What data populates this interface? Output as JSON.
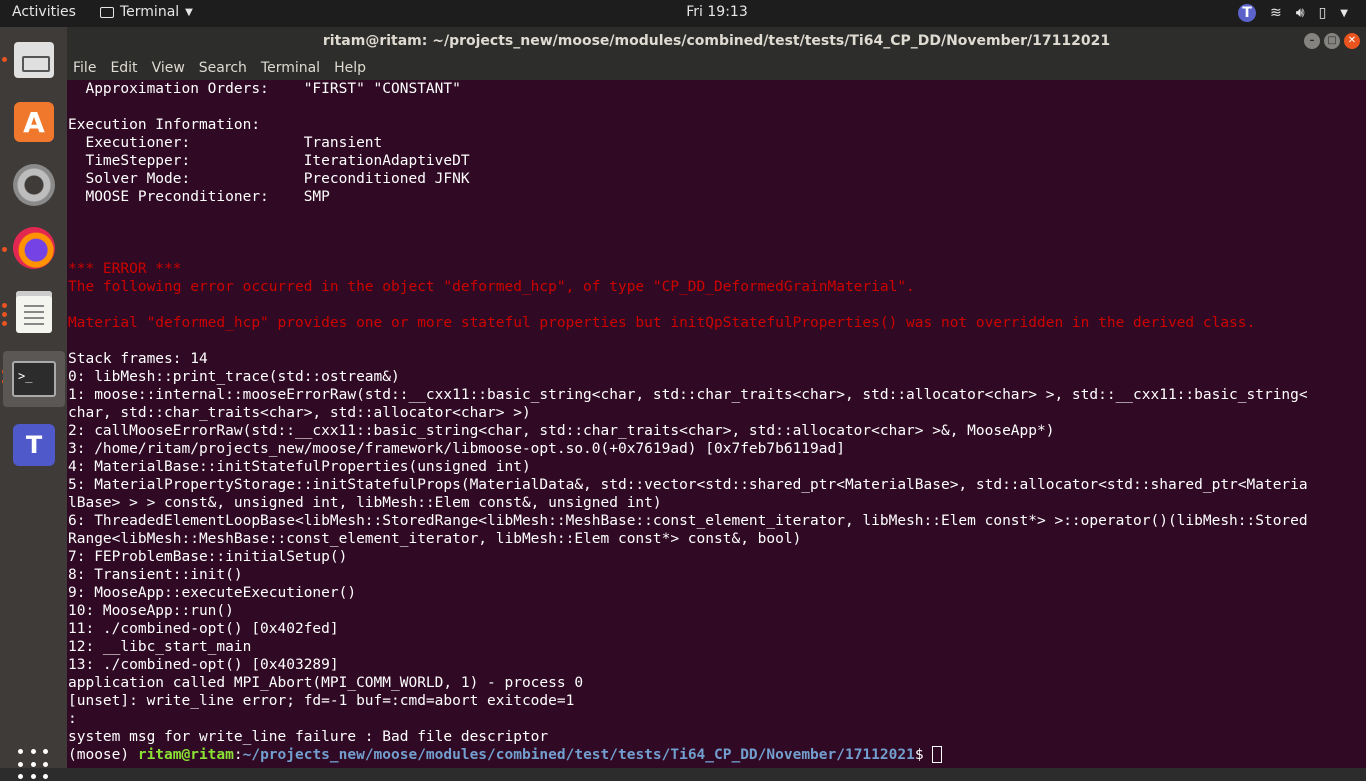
{
  "topbar": {
    "activities": "Activities",
    "app_name": "Terminal",
    "clock": "Fri 19:13"
  },
  "dock": {
    "items": [
      "files",
      "software-center",
      "settings",
      "firefox",
      "text-editor",
      "terminal",
      "teams"
    ],
    "accent": "#e95420"
  },
  "window": {
    "title": "ritam@ritam: ~/projects_new/moose/modules/combined/test/tests/Ti64_CP_DD/November/17112021",
    "menu": [
      "File",
      "Edit",
      "View",
      "Search",
      "Terminal",
      "Help"
    ]
  },
  "terminal": {
    "background": "#300a24",
    "lines": [
      {
        "text": "  Approximation Orders:    \"FIRST\" \"CONSTANT\"",
        "err": false
      },
      {
        "text": "",
        "err": false
      },
      {
        "text": "Execution Information:",
        "err": false
      },
      {
        "text": "  Executioner:             Transient",
        "err": false
      },
      {
        "text": "  TimeStepper:             IterationAdaptiveDT",
        "err": false
      },
      {
        "text": "  Solver Mode:             Preconditioned JFNK",
        "err": false
      },
      {
        "text": "  MOOSE Preconditioner:    SMP",
        "err": false
      },
      {
        "text": "",
        "err": false
      },
      {
        "text": "",
        "err": false
      },
      {
        "text": "",
        "err": false
      },
      {
        "text": "*** ERROR ***",
        "err": true
      },
      {
        "text": "The following error occurred in the object \"deformed_hcp\", of type \"CP_DD_DeformedGrainMaterial\".",
        "err": true
      },
      {
        "text": "",
        "err": false
      },
      {
        "text": "Material \"deformed_hcp\" provides one or more stateful properties but initQpStatefulProperties() was not overridden in the derived class.",
        "err": true
      },
      {
        "text": "",
        "err": false
      },
      {
        "text": "Stack frames: 14",
        "err": false
      },
      {
        "text": "0: libMesh::print_trace(std::ostream&)",
        "err": false
      },
      {
        "text": "1: moose::internal::mooseErrorRaw(std::__cxx11::basic_string<char, std::char_traits<char>, std::allocator<char> >, std::__cxx11::basic_string<",
        "err": false
      },
      {
        "text": "char, std::char_traits<char>, std::allocator<char> >)",
        "err": false
      },
      {
        "text": "2: callMooseErrorRaw(std::__cxx11::basic_string<char, std::char_traits<char>, std::allocator<char> >&, MooseApp*)",
        "err": false
      },
      {
        "text": "3: /home/ritam/projects_new/moose/framework/libmoose-opt.so.0(+0x7619ad) [0x7feb7b6119ad]",
        "err": false
      },
      {
        "text": "4: MaterialBase::initStatefulProperties(unsigned int)",
        "err": false
      },
      {
        "text": "5: MaterialPropertyStorage::initStatefulProps(MaterialData&, std::vector<std::shared_ptr<MaterialBase>, std::allocator<std::shared_ptr<Materia",
        "err": false
      },
      {
        "text": "lBase> > > const&, unsigned int, libMesh::Elem const&, unsigned int)",
        "err": false
      },
      {
        "text": "6: ThreadedElementLoopBase<libMesh::StoredRange<libMesh::MeshBase::const_element_iterator, libMesh::Elem const*> >::operator()(libMesh::Stored",
        "err": false
      },
      {
        "text": "Range<libMesh::MeshBase::const_element_iterator, libMesh::Elem const*> const&, bool)",
        "err": false
      },
      {
        "text": "7: FEProblemBase::initialSetup()",
        "err": false
      },
      {
        "text": "8: Transient::init()",
        "err": false
      },
      {
        "text": "9: MooseApp::executeExecutioner()",
        "err": false
      },
      {
        "text": "10: MooseApp::run()",
        "err": false
      },
      {
        "text": "11: ./combined-opt() [0x402fed]",
        "err": false
      },
      {
        "text": "12: __libc_start_main",
        "err": false
      },
      {
        "text": "13: ./combined-opt() [0x403289]",
        "err": false
      },
      {
        "text": "application called MPI_Abort(MPI_COMM_WORLD, 1) - process 0",
        "err": false
      },
      {
        "text": "[unset]: write_line error; fd=-1 buf=:cmd=abort exitcode=1",
        "err": false
      },
      {
        "text": ":",
        "err": false
      },
      {
        "text": "system msg for write_line failure : Bad file descriptor",
        "err": false
      }
    ],
    "prompt": {
      "env": "(moose) ",
      "user_host": "ritam@ritam",
      "colon": ":",
      "path": "~/projects_new/moose/modules/combined/test/tests/Ti64_CP_DD/November/17112021",
      "symbol": "$ "
    }
  }
}
